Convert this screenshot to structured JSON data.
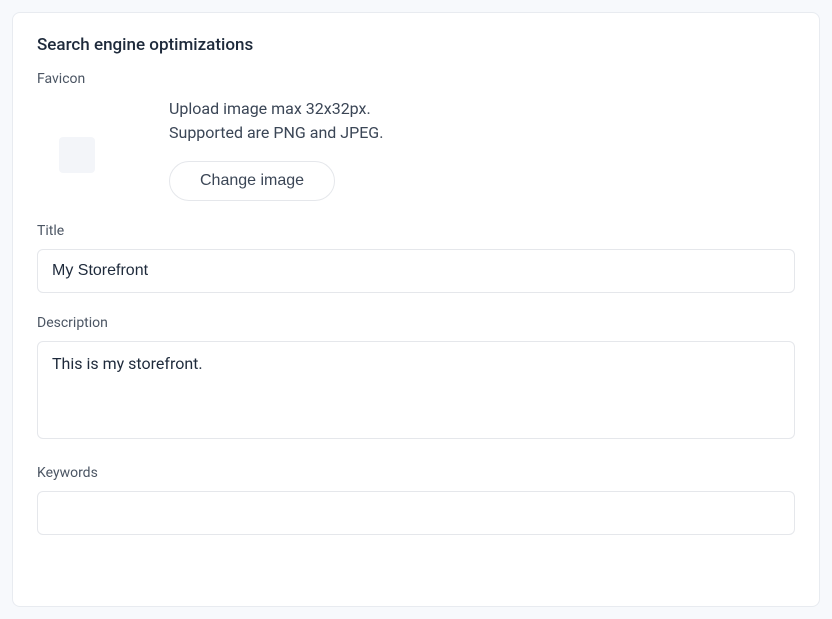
{
  "card": {
    "title": "Search engine optimizations"
  },
  "favicon": {
    "label": "Favicon",
    "hint_line1": "Upload image max 32x32px.",
    "hint_line2": "Supported are PNG and JPEG.",
    "change_button": "Change image"
  },
  "title_field": {
    "label": "Title",
    "value": "My Storefront"
  },
  "description_field": {
    "label": "Description",
    "value": "This is my storefront."
  },
  "keywords_field": {
    "label": "Keywords",
    "value": ""
  }
}
